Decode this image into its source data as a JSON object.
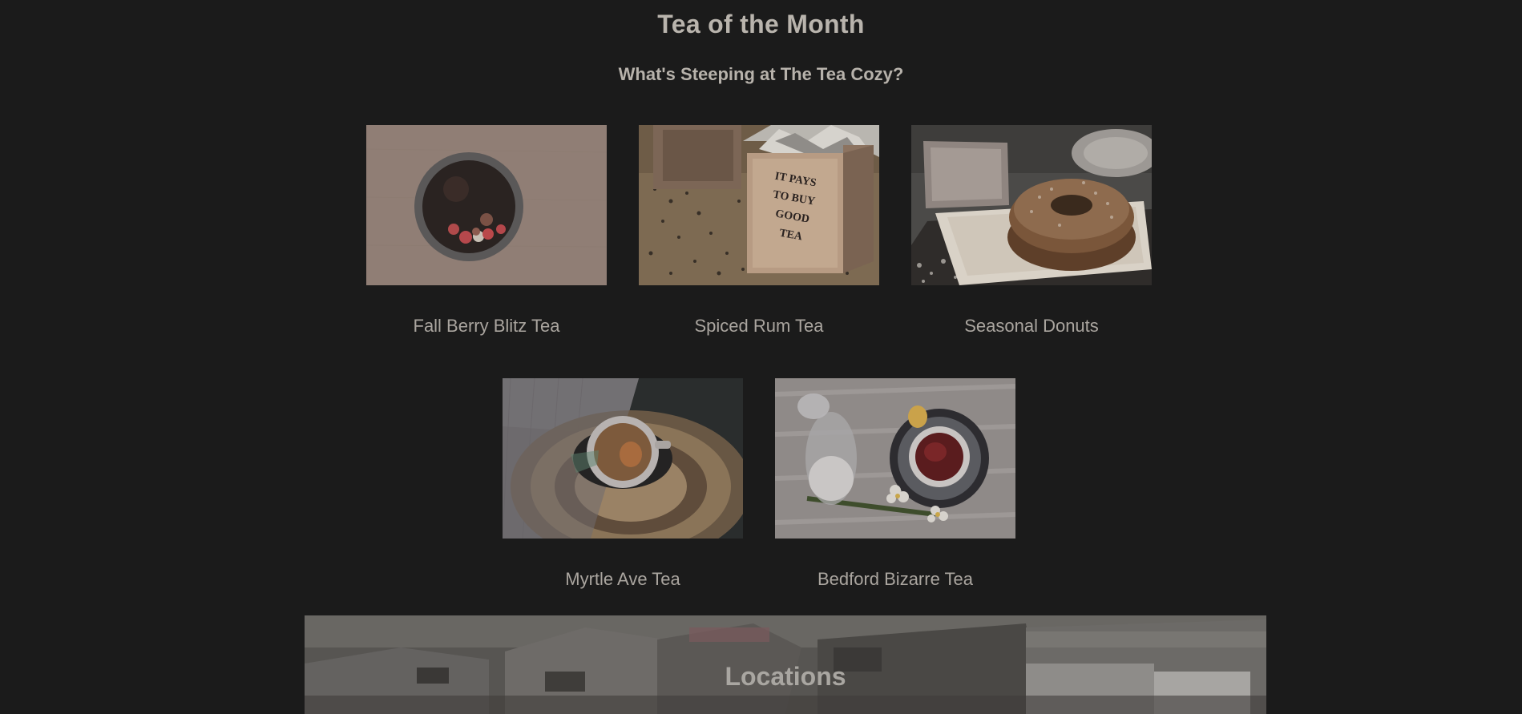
{
  "section": {
    "title": "Tea of the Month",
    "subtitle": "What's Steeping at The Tea Cozy?"
  },
  "items": [
    {
      "caption": "Fall Berry Blitz Tea"
    },
    {
      "caption": "Spiced Rum Tea",
      "box_text": [
        "IT PAYS",
        "TO BUY",
        "GOOD",
        "TEA"
      ]
    },
    {
      "caption": "Seasonal Donuts"
    },
    {
      "caption": "Myrtle Ave Tea"
    },
    {
      "caption": "Bedford Bizarre Tea"
    }
  ],
  "locations": {
    "title": "Locations"
  }
}
